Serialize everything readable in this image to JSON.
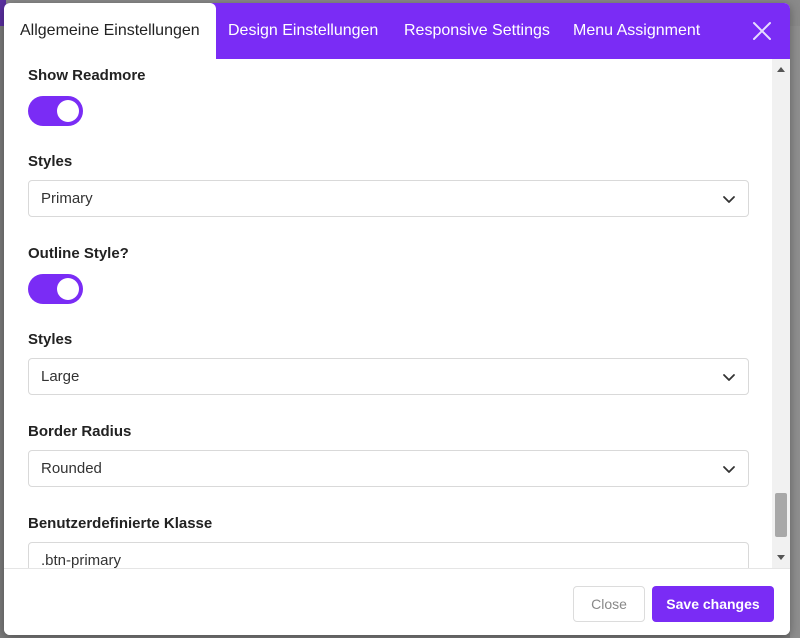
{
  "tabs": [
    {
      "label": "Allgemeine Einstellungen",
      "active": true
    },
    {
      "label": "Design Einstellungen",
      "active": false
    },
    {
      "label": "Responsive Settings",
      "active": false
    },
    {
      "label": "Menu Assignment",
      "active": false
    }
  ],
  "fields": {
    "show_readmore": {
      "label": "Show Readmore",
      "enabled": true
    },
    "styles_1": {
      "label": "Styles",
      "value": "Primary"
    },
    "outline_style": {
      "label": "Outline Style?",
      "enabled": true
    },
    "styles_2": {
      "label": "Styles",
      "value": "Large"
    },
    "border_radius": {
      "label": "Border Radius",
      "value": "Rounded"
    },
    "custom_class": {
      "label": "Benutzerdefinierte Klasse",
      "value": ".btn-primary"
    }
  },
  "footer": {
    "close_label": "Close",
    "save_label": "Save changes"
  },
  "colors": {
    "accent": "#7a2cf5",
    "tab_text": "#ffffff"
  },
  "icons": {
    "close": "close-icon",
    "chevron": "chevron-down-icon"
  }
}
